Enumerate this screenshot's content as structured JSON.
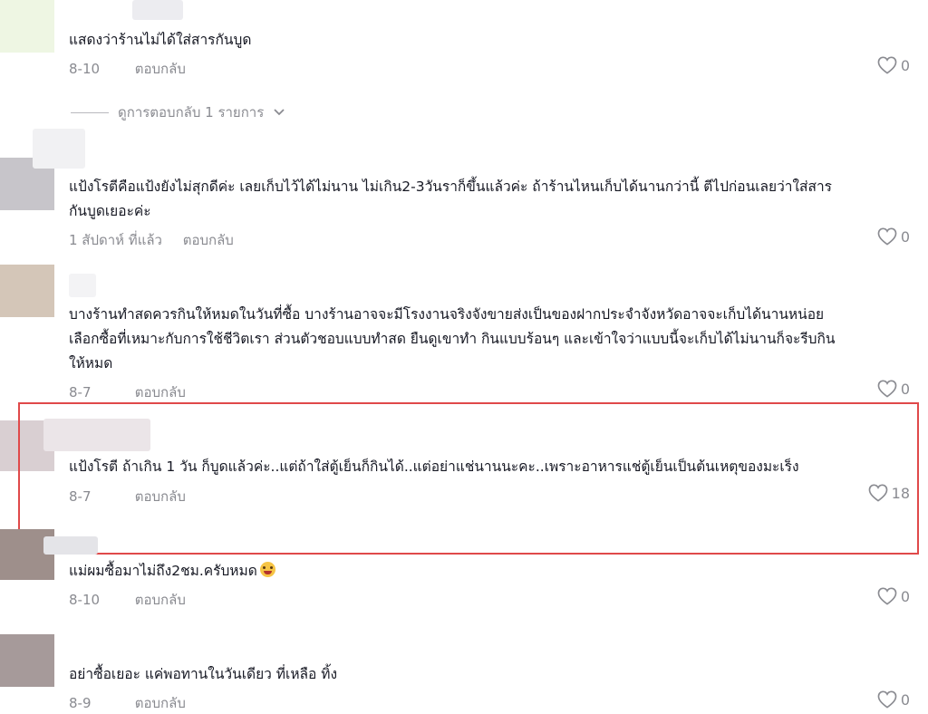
{
  "comments": [
    {
      "text": "แสดงว่าร้านไม่ได้ใส่สารกันบูด",
      "date": "8-10",
      "likes": "0"
    },
    {
      "text_lines": [
        "แป้งโรตีคือแป้งยังไม่สุกดีค่ะ เลยเก็บไว้ได้ไม่นาน ไม่เกิน2-3วันราก็ขึ้นแล้วค่ะ ถ้าร้านไหนเก็บได้นานกว่านี้ ตีไปก่อนเลยว่าใส่สาร",
        "กันบูดเยอะค่ะ"
      ],
      "date": "1 สัปดาห์ ที่แล้ว",
      "likes": "0"
    },
    {
      "text_lines": [
        "บางร้านทำสดควรกินให้หมดในวันที่ซื้อ บางร้านอาจจะมีโรงงานจริงจังขายส่งเป็นของฝากประจำจังหวัดอาจจะเก็บได้นานหน่อย",
        "เลือกซื้อที่เหมาะกับการใช้ชีวิตเรา ส่วนตัวชอบแบบทำสด ยืนดูเขาทำ กินแบบร้อนๆ และเข้าใจว่าแบบนี้จะเก็บได้ไม่นานก็จะรีบกิน",
        "ให้หมด"
      ],
      "date": "8-7",
      "likes": "0"
    },
    {
      "text": "แป้งโรตี ถ้าเกิน 1 วัน ก็บูดแล้วค่ะ..แต่ถ้าใส่ตู้เย็นก็กินได้..แต่อย่าแช่นานนะคะ..เพราะอาหารแช่ตู้เย็นเป็นต้นเหตุของมะเร็ง",
      "date": "8-7",
      "likes": "18"
    },
    {
      "text": "แม่ผมซื้อมาไม่ถึง2ชม.ครับหมด",
      "date": "8-10",
      "likes": "0"
    },
    {
      "text": "อย่าซื้อเยอะ แค่พอทานในวันเดียว ที่เหลือ ทิ้ง",
      "date": "8-9",
      "likes": "0"
    }
  ],
  "reply_label": "ตอบกลับ",
  "view_replies": "ดูการตอบกลับ 1 รายการ",
  "icons": {
    "like": "heart-outline-icon",
    "expand": "chevron-down-icon",
    "emoji": "face-holding-back-tears-emoji"
  },
  "colors": {
    "text": "#161823",
    "meta": "#8a8b91",
    "highlight": "#e0494a"
  }
}
